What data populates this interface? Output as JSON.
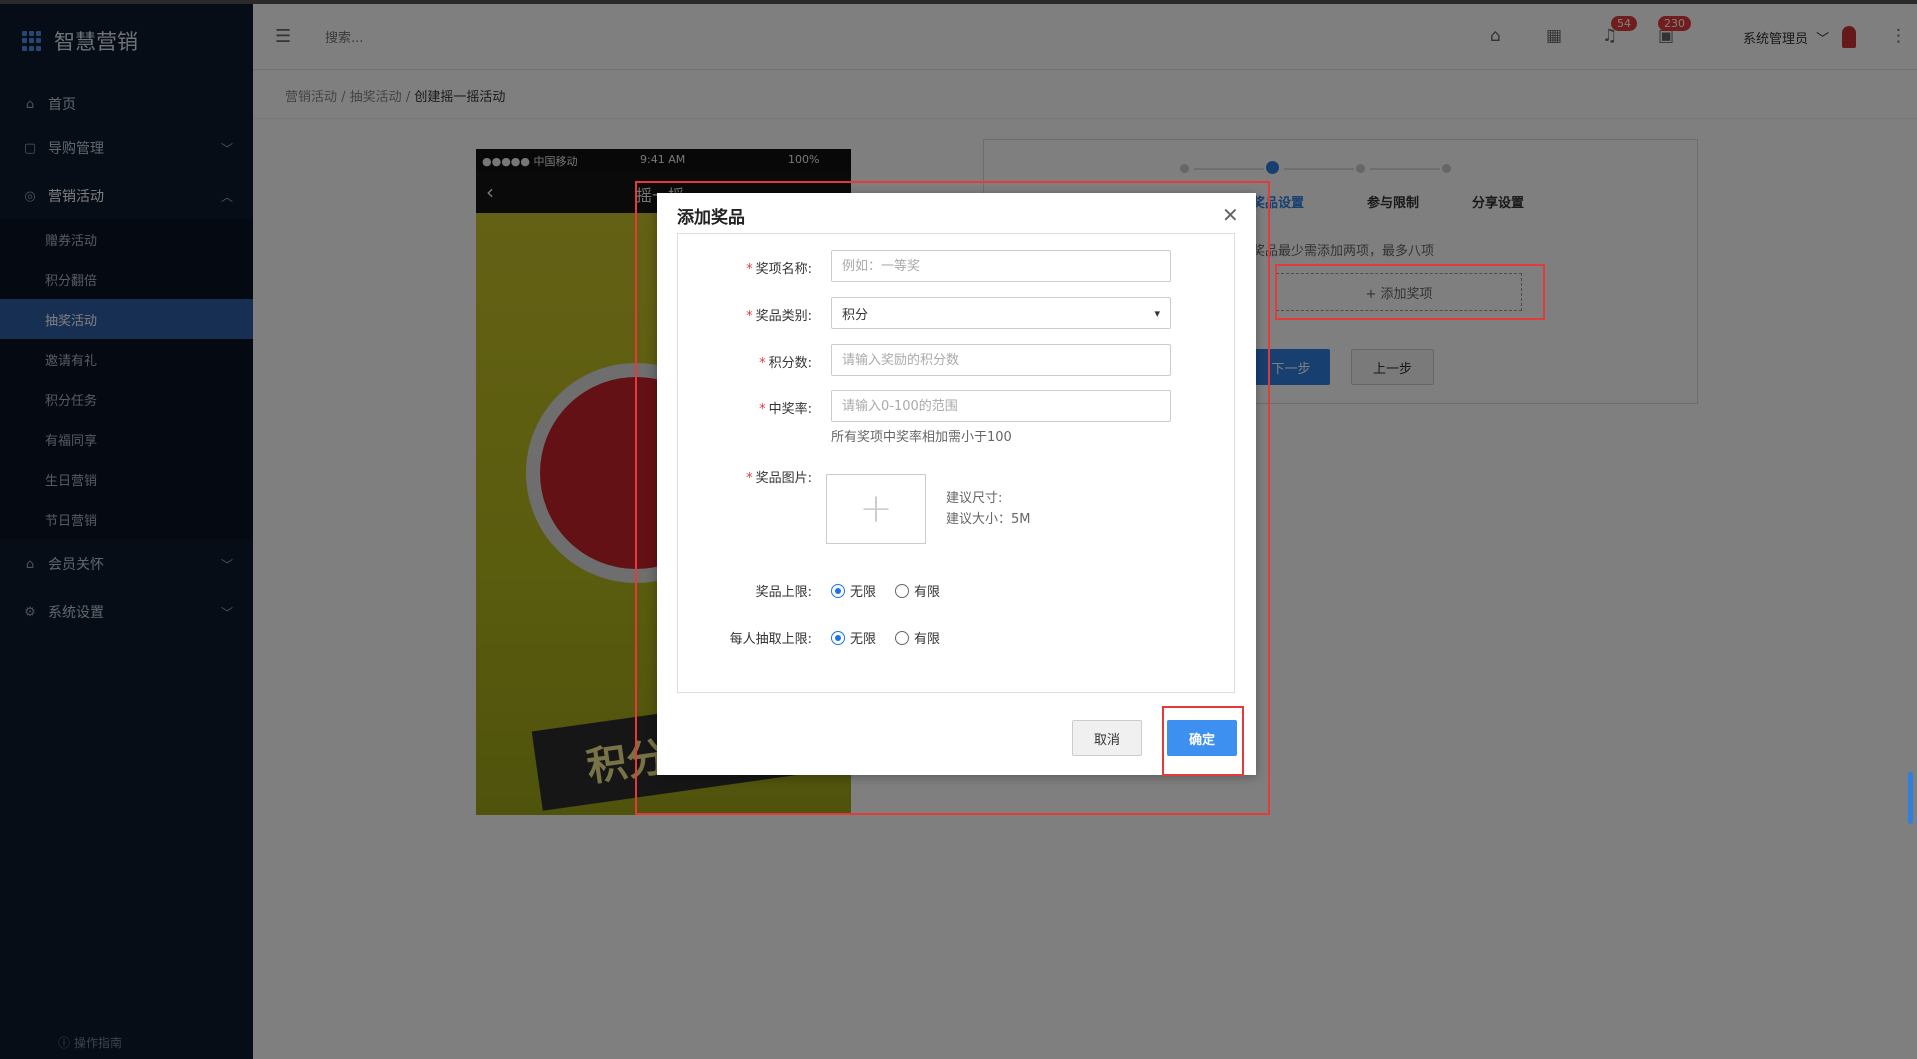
{
  "app": {
    "title": "智慧营销"
  },
  "sidebar": {
    "items": [
      {
        "label": "首页",
        "icon": "home-icon"
      },
      {
        "label": "导购管理",
        "icon": "bag-icon"
      },
      {
        "label": "营销活动",
        "icon": "marketing-icon"
      },
      {
        "label": "会员关怀",
        "icon": "home-icon"
      },
      {
        "label": "系统设置",
        "icon": "gear-icon"
      }
    ],
    "sub_items": [
      "赠券活动",
      "积分翻倍",
      "抽奖活动",
      "邀请有礼",
      "积分任务",
      "有福同享",
      "生日营销",
      "节日营销"
    ],
    "active_sub": "抽奖活动",
    "guide_label": "操作指南"
  },
  "header": {
    "search_placeholder": "搜索...",
    "notifications_count": "54",
    "messages_count": "230",
    "user_name": "系统管理员"
  },
  "breadcrumb": [
    "营销活动",
    "抽奖活动",
    "创建摇一摇活动"
  ],
  "phone": {
    "carrier": "●●●●● 中国移动",
    "time": "9:41 AM",
    "battery": "100%",
    "title": "摇一摇",
    "banner_text": "积分可以"
  },
  "steps": {
    "labels": [
      "奖品设置",
      "参与限制",
      "分享设置"
    ],
    "active_index": 1,
    "note": "奖品最少需添加两项，最多八项",
    "add_prize_label": "+ 添加奖项",
    "next_label": "下一步",
    "prev_label": "上一步"
  },
  "modal": {
    "title": "添加奖品",
    "fields": {
      "name_label": "奖项名称:",
      "name_placeholder": "例如：一等奖",
      "category_label": "奖品类别:",
      "category_value": "积分",
      "points_label": "积分数:",
      "points_placeholder": "请输入奖励的积分数",
      "rate_label": "中奖率:",
      "rate_placeholder": "请输入0-100的范围",
      "rate_hint": "所有奖项中奖率相加需小于100",
      "image_label": "奖品图片:",
      "image_hint_size": "建议尺寸:",
      "image_hint_weight": "建议大小：5M",
      "limit_label": "奖品上限:",
      "per_person_label": "每人抽取上限:",
      "option_unlimited": "无限",
      "option_limited": "有限"
    },
    "cancel_label": "取消",
    "confirm_label": "确定"
  }
}
